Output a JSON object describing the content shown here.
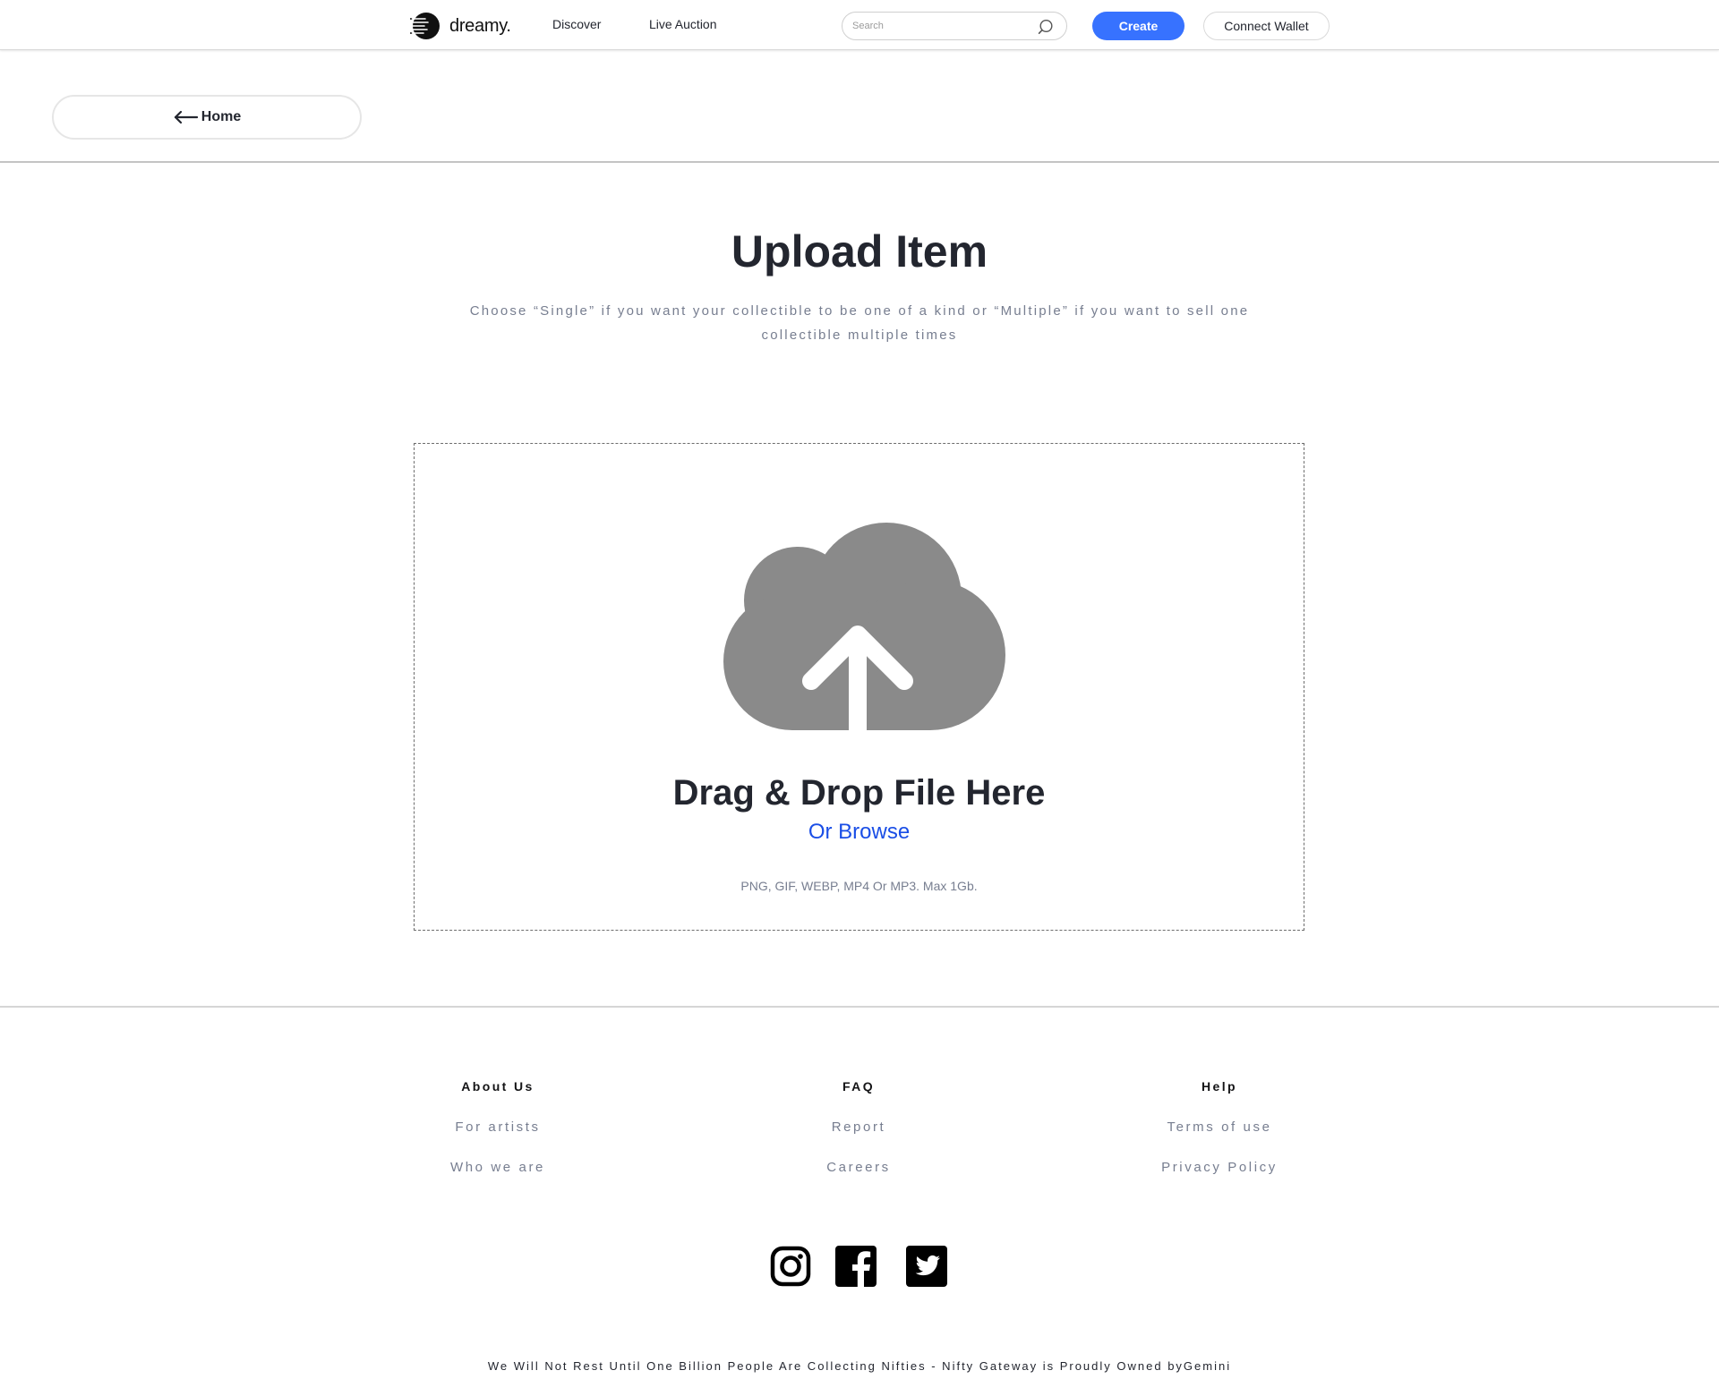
{
  "header": {
    "brand": "dreamy.",
    "nav": [
      {
        "label": "Discover"
      },
      {
        "label": "Live Auction"
      }
    ],
    "search": {
      "placeholder": "Search",
      "value": ""
    },
    "create_label": "Create",
    "wallet_label": "Connect Wallet",
    "accent_color": "#3772ff"
  },
  "home": {
    "label": "Home",
    "icon": "arrow-left-icon"
  },
  "upload": {
    "title": "Upload Item",
    "subtitle": "Choose “Single” if you want your collectible to be one of a kind or “Multiple” if you want to sell one collectible multiple times",
    "drop_title": "Drag & Drop File Here",
    "browse_label": "Or Browse",
    "file_hint": "PNG, GIF, WEBP, MP4 Or MP3. Max 1Gb.",
    "icon": "cloud-upload-icon",
    "icon_color": "#8a8a8a",
    "link_color": "#1a4ee6"
  },
  "footer": {
    "columns": [
      {
        "heading": "About Us",
        "links": [
          "For artists",
          "Who we are"
        ]
      },
      {
        "heading": "FAQ",
        "links": [
          "Report",
          "Careers"
        ]
      },
      {
        "heading": "Help",
        "links": [
          "Terms of use",
          "Privacy Policy"
        ]
      }
    ],
    "social": [
      "instagram-icon",
      "facebook-icon",
      "twitter-icon"
    ],
    "tagline": "We Will Not Rest Until One Billion People Are Collecting Nifties - Nifty Gateway is Proudly Owned byGemini"
  }
}
